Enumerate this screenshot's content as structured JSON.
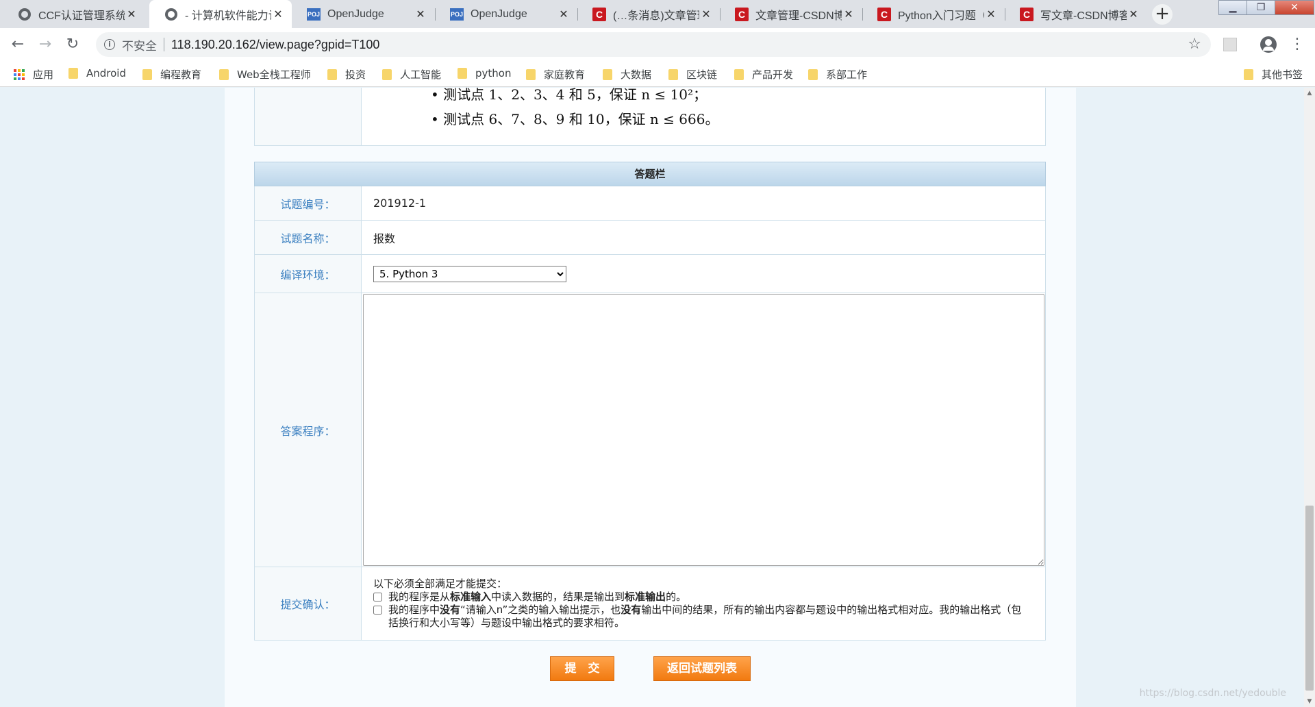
{
  "tabs": [
    {
      "title": "CCF认证管理系统",
      "favicon": "globe-icon"
    },
    {
      "title": "- 计算机软件能力认证",
      "favicon": "globe-icon",
      "active": true
    },
    {
      "title": "OpenJudge",
      "favicon": "poj-icon"
    },
    {
      "title": "OpenJudge",
      "favicon": "poj-icon"
    },
    {
      "title": "(…条消息)文章管理",
      "favicon": "csdn-icon"
    },
    {
      "title": "文章管理-CSDN博客",
      "favicon": "csdn-icon"
    },
    {
      "title": "Python入门习题（",
      "favicon": "csdn-icon"
    },
    {
      "title": "写文章-CSDN博客",
      "favicon": "csdn-icon"
    }
  ],
  "favicon_text": {
    "poj": "POJ",
    "csdn": "C"
  },
  "close_glyph": "✕",
  "new_tab_glyph": "+",
  "address": {
    "security_label": "不安全",
    "url": "118.190.20.162/view.page?gpid=T100"
  },
  "bookmarks": [
    {
      "label": "应用",
      "icon": "apps-icon"
    },
    {
      "label": "Android"
    },
    {
      "label": "编程教育"
    },
    {
      "label": "Web全栈工程师"
    },
    {
      "label": "投资"
    },
    {
      "label": "人工智能"
    },
    {
      "label": "python"
    },
    {
      "label": "家庭教育"
    },
    {
      "label": "大数据"
    },
    {
      "label": "区块链"
    },
    {
      "label": "产品开发"
    },
    {
      "label": "系部工作"
    }
  ],
  "bookmarks_other": "其他书签",
  "problem_tail": {
    "bullet1": "• 测试点 1、2、3、4 和 5，保证 n ≤ 10²；",
    "bullet2": "• 测试点 6、7、8、9 和 10，保证 n ≤ 666。"
  },
  "answer": {
    "header": "答题栏",
    "id_label": "试题编号：",
    "id_value": "201912-1",
    "name_label": "试题名称：",
    "name_value": "报数",
    "env_label": "编译环境：",
    "env_selected": "5. Python 3",
    "code_label": "答案程序：",
    "code_value": "",
    "confirm_label": "提交确认：",
    "confirm_intro": "以下必须全部满足才能提交：",
    "check1_parts": [
      "我的程序是从",
      "标准输入",
      "中读入数据的，结果是输出到",
      "标准输出",
      "的。"
    ],
    "check2_parts": [
      "我的程序中",
      "没有",
      "“请输入n”之类的输入输出提示，也",
      "没有",
      "输出中间的结果，所有的输出内容都与题设中的输出格式相对应。我的输出格式（包括换行和大小写等）与题设中输出格式的要求相符。"
    ]
  },
  "buttons": {
    "submit": "提　交",
    "back": "返回试题列表"
  },
  "watermark": "https://blog.csdn.net/yedouble",
  "colors": {
    "accent_orange": "#f58a1f",
    "label_blue": "#3a7fc0",
    "csdn_red": "#c9181f",
    "header_band": "#c6dcee"
  }
}
